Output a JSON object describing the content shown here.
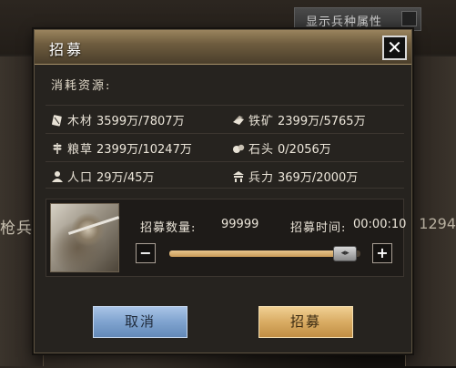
{
  "background": {
    "toggle_label": "显示兵种属性",
    "left_text": "枪兵",
    "right_text": "1294"
  },
  "dialog": {
    "title": "招募",
    "close_label": "✕",
    "section_label": "消耗资源:",
    "resources": [
      {
        "name": "木材",
        "icon": "wood-icon",
        "value": "3599万/7807万"
      },
      {
        "name": "铁矿",
        "icon": "iron-ore-icon",
        "value": "2399万/5765万"
      },
      {
        "name": "粮草",
        "icon": "grain-icon",
        "value": "2399万/10247万"
      },
      {
        "name": "石头",
        "icon": "stone-icon",
        "value": "0/2056万"
      },
      {
        "name": "人口",
        "icon": "population-icon",
        "value": "29万/45万"
      },
      {
        "name": "兵力",
        "icon": "troops-icon",
        "value": "369万/2000万"
      }
    ],
    "recruit": {
      "count_label": "招募数量:",
      "count_value": "99999",
      "time_label": "招募时间:",
      "time_value": "00:00:10",
      "slider_fraction": 0.92,
      "minus_label": "−",
      "plus_label": "+"
    },
    "buttons": {
      "cancel": "取消",
      "confirm": "招募"
    }
  },
  "colors": {
    "title_gold": "#9a845e",
    "cancel_blue": "#7fa3cf",
    "confirm_gold": "#d9ac63",
    "slider_fill": "#d8b070"
  }
}
